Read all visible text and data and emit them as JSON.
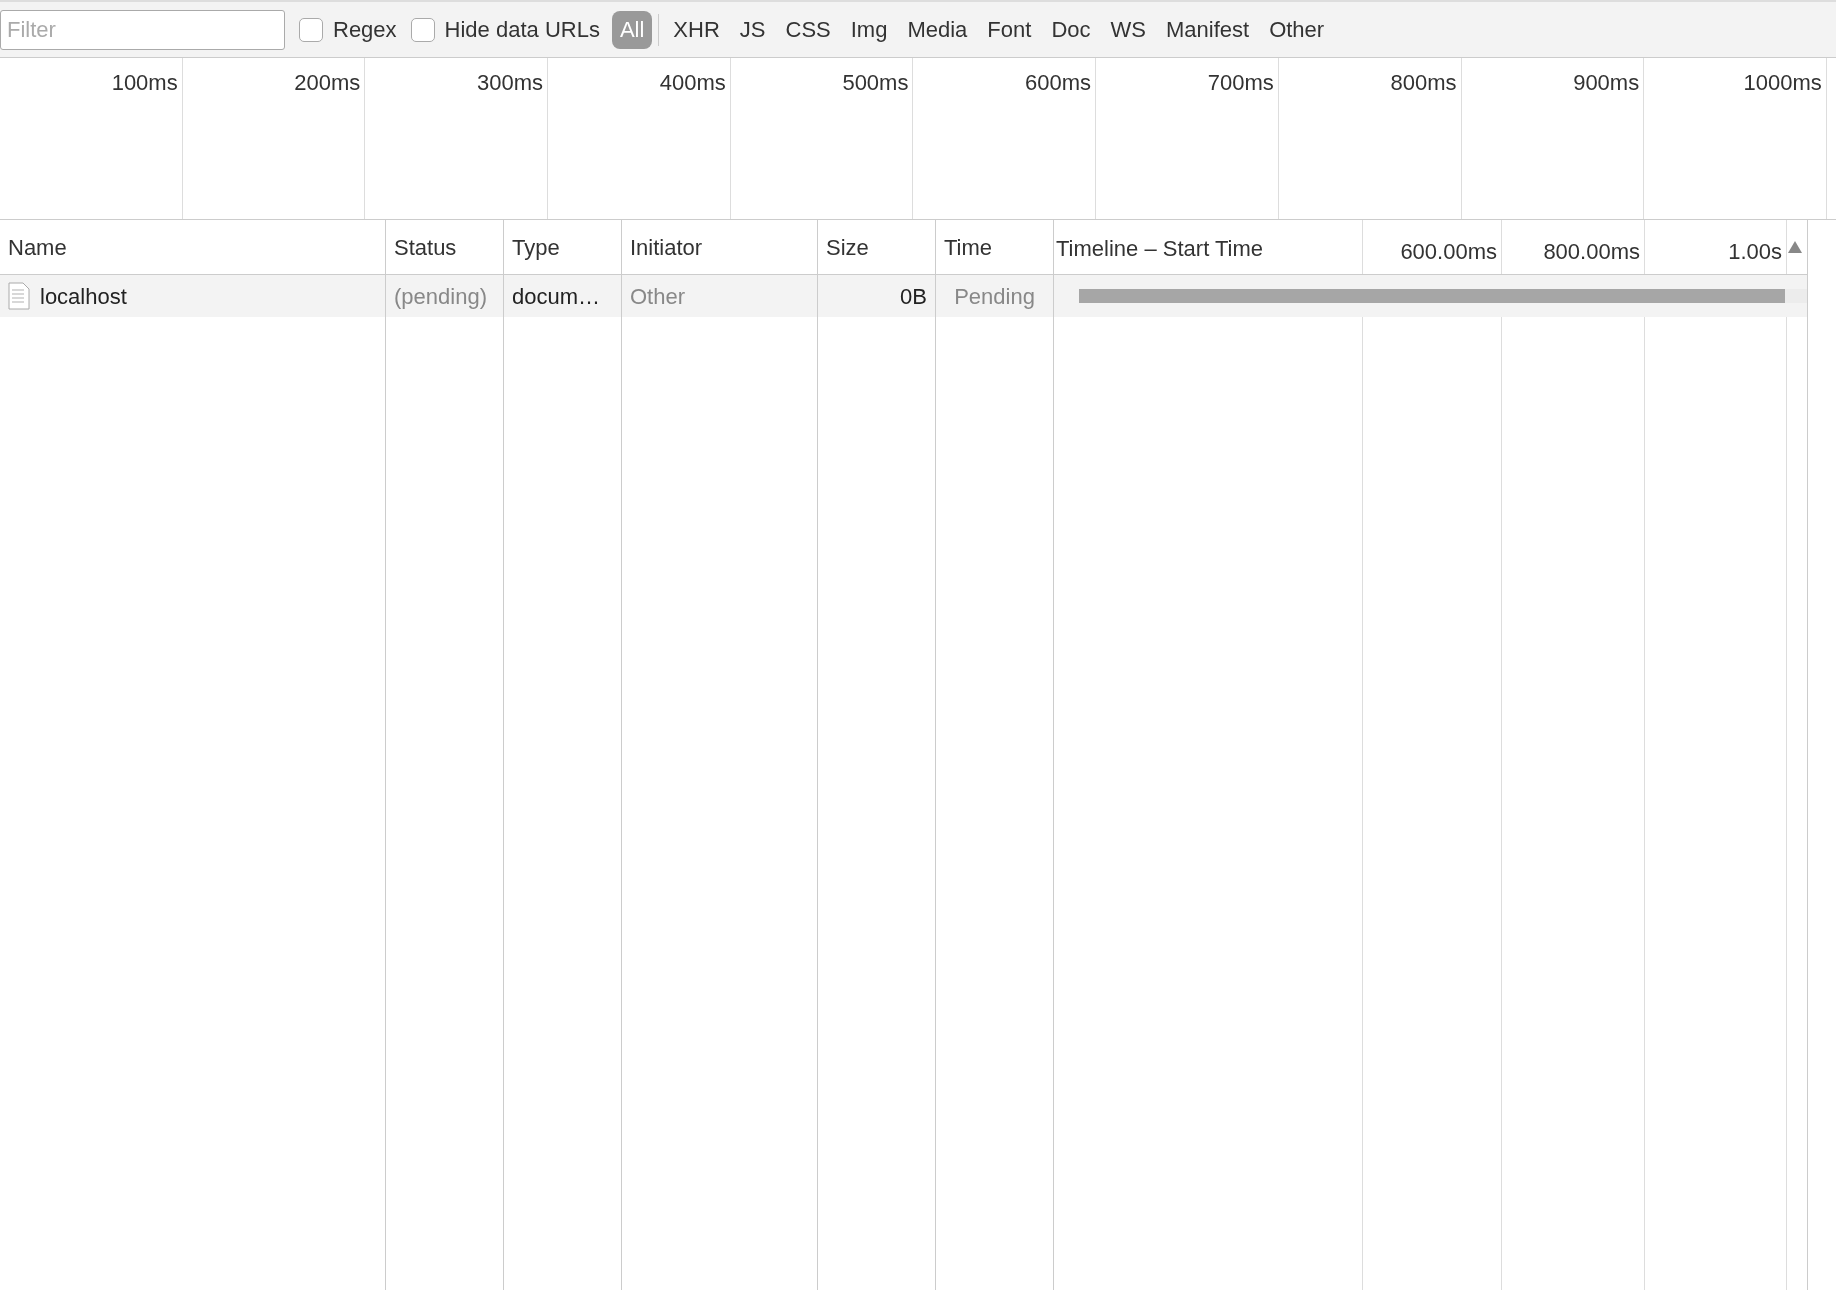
{
  "toolbar": {
    "filter": {
      "placeholder": "Filter"
    },
    "checkboxes": [
      {
        "label": "Regex",
        "checked": false
      },
      {
        "label": "Hide data URLs",
        "checked": false
      }
    ],
    "types": [
      {
        "label": "All",
        "selected": true
      },
      {
        "label": "XHR",
        "selected": false
      },
      {
        "label": "JS",
        "selected": false
      },
      {
        "label": "CSS",
        "selected": false
      },
      {
        "label": "Img",
        "selected": false
      },
      {
        "label": "Media",
        "selected": false
      },
      {
        "label": "Font",
        "selected": false
      },
      {
        "label": "Doc",
        "selected": false
      },
      {
        "label": "WS",
        "selected": false
      },
      {
        "label": "Manifest",
        "selected": false
      },
      {
        "label": "Other",
        "selected": false
      }
    ]
  },
  "overview": {
    "ticks": [
      "100ms",
      "200ms",
      "300ms",
      "400ms",
      "500ms",
      "600ms",
      "700ms",
      "800ms",
      "900ms",
      "1000ms"
    ]
  },
  "table": {
    "columns": [
      "Name",
      "Status",
      "Type",
      "Initiator",
      "Size",
      "Time"
    ],
    "timeline": {
      "title": "Timeline – Start Time",
      "ticks": [
        "600.00ms",
        "800.00ms",
        "1.00s"
      ]
    },
    "rows": [
      {
        "name": "localhost",
        "status": "(pending)",
        "type": "docum…",
        "initiator": "Other",
        "size": "0B",
        "time": "Pending",
        "level": 0.97
      }
    ]
  }
}
